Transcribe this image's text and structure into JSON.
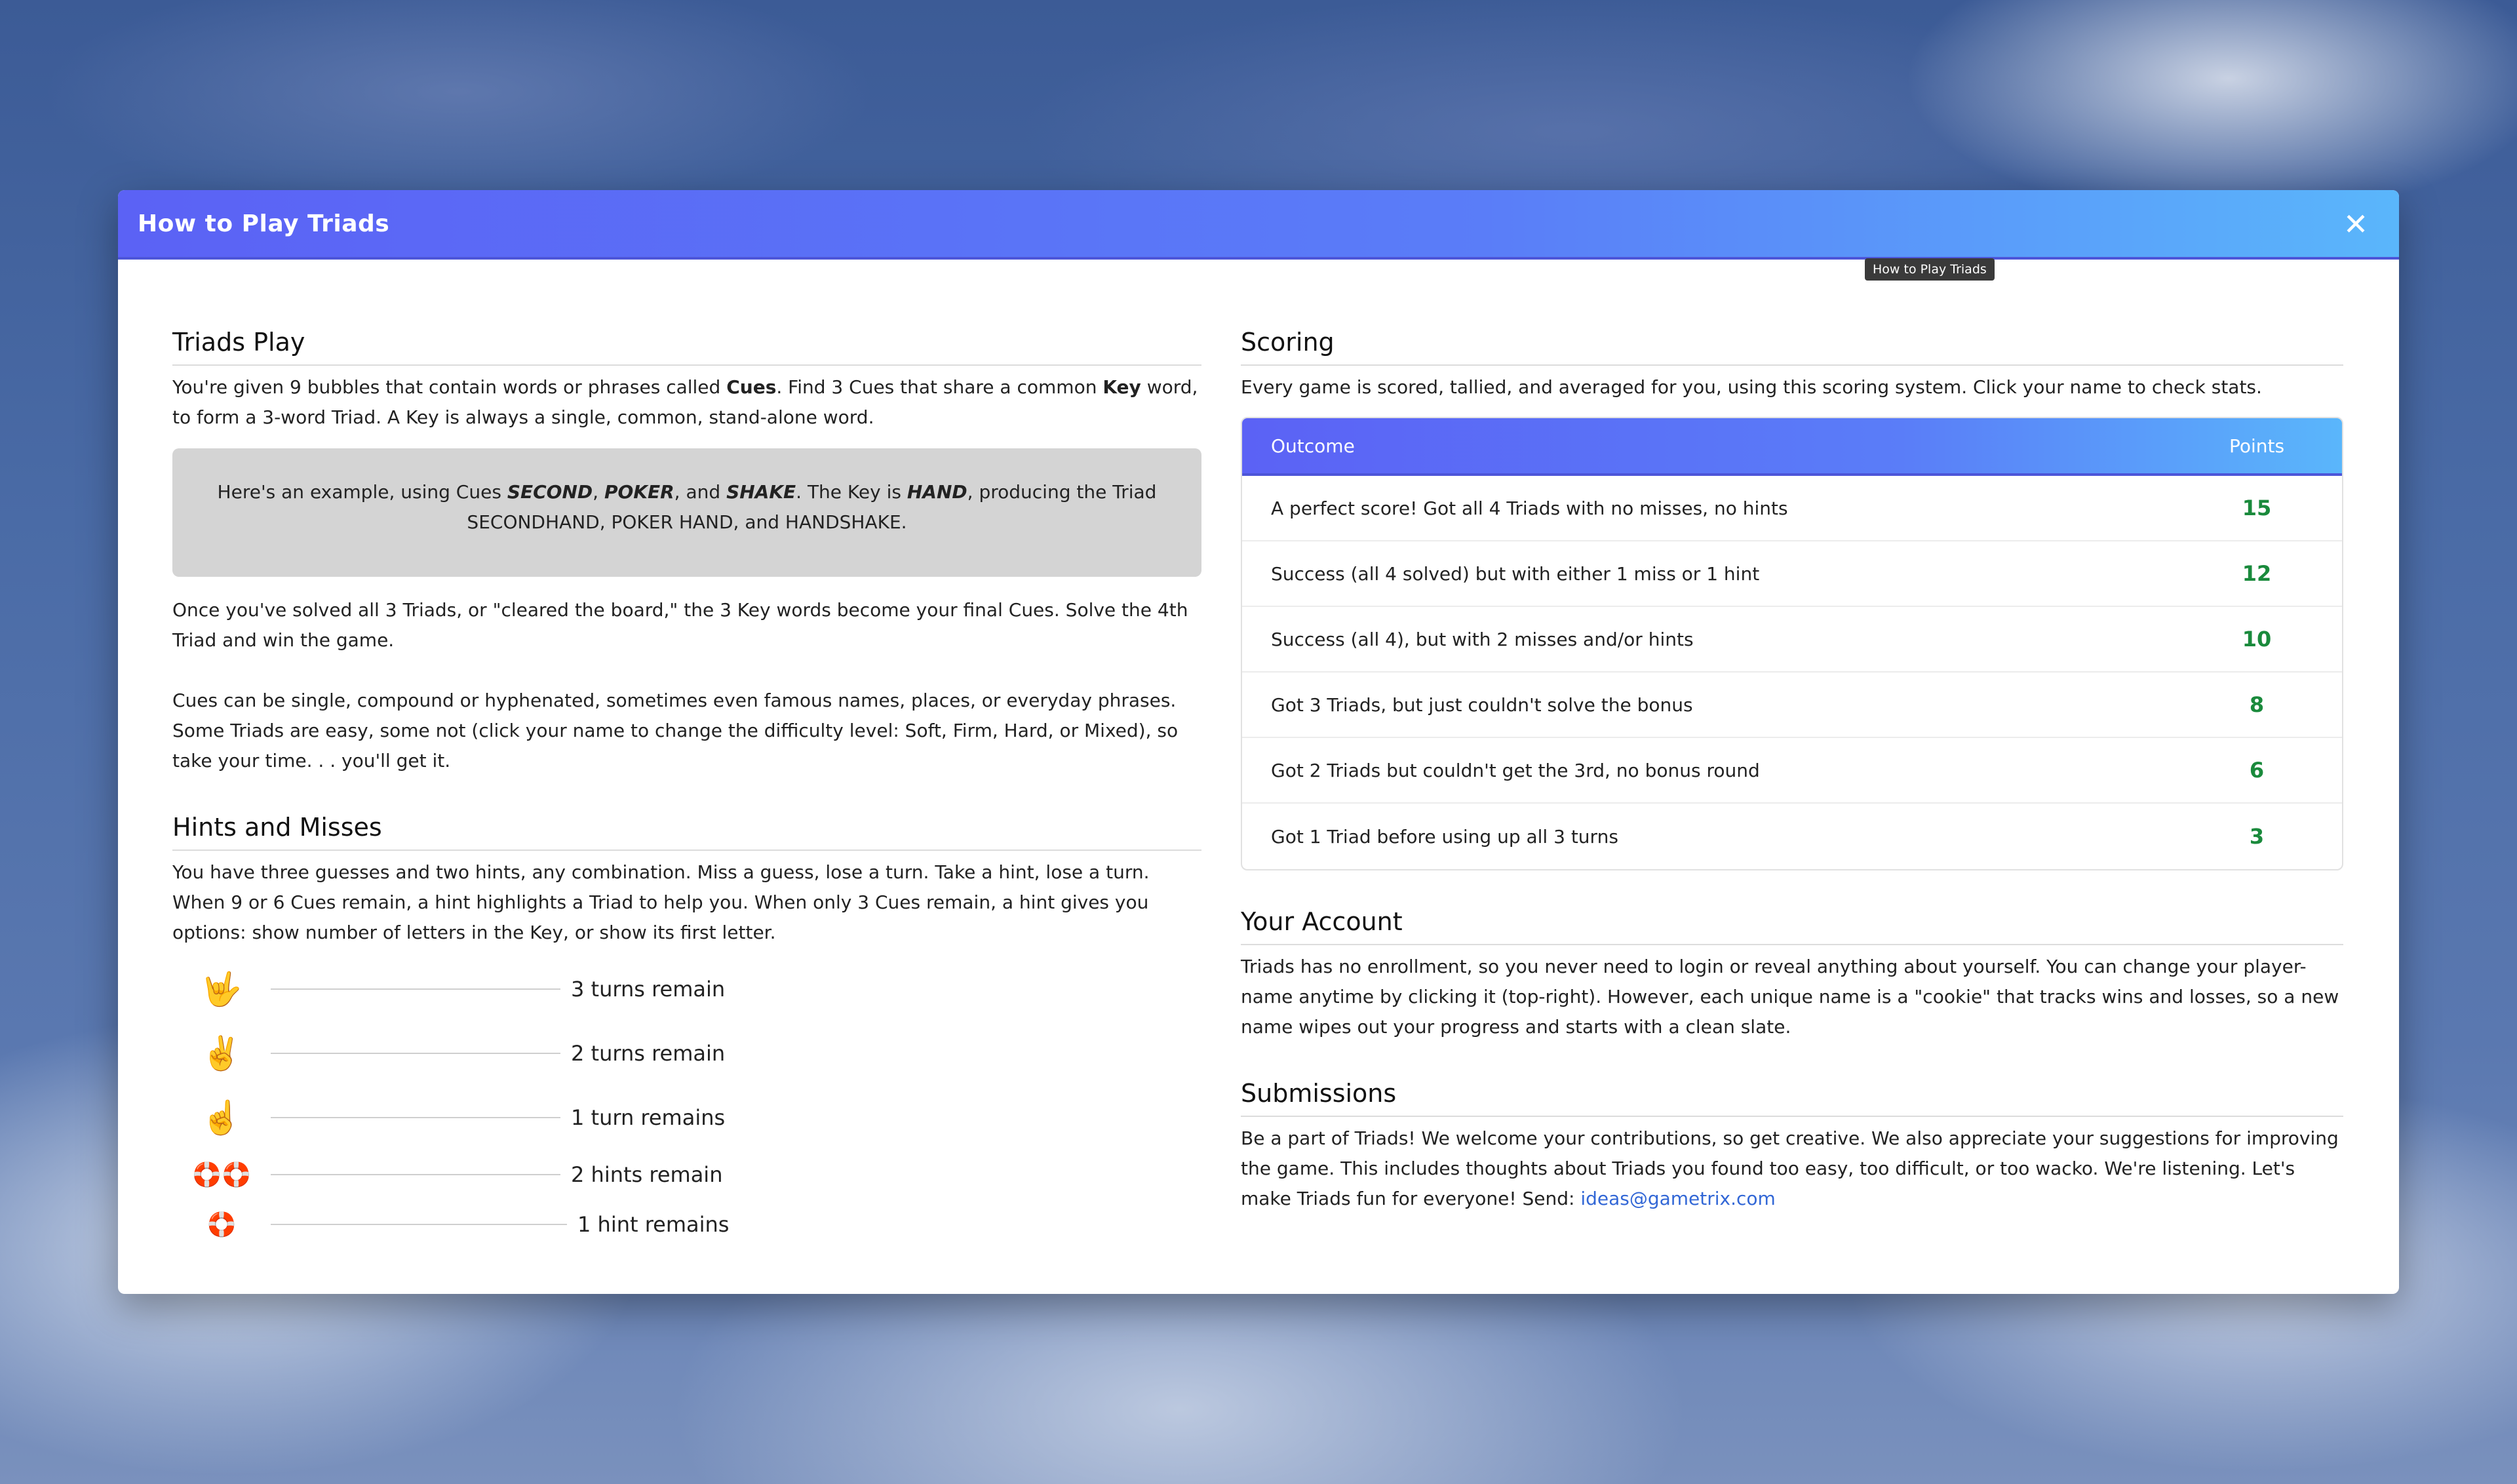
{
  "modal": {
    "title": "How to Play Triads",
    "close_icon": "close-icon",
    "tooltip": "How to Play Triads"
  },
  "triads_play": {
    "heading": "Triads Play",
    "intro_part1": "You're given 9 bubbles that contain words or phrases called ",
    "intro_bold1": "Cues",
    "intro_part2": ". Find 3 Cues that share a common ",
    "intro_bold2": "Key",
    "intro_part3": " word, to form a 3-word Triad. A Key is always a single, common, stand-alone word.",
    "example_part1": "Here's an example, using Cues ",
    "example_cue1": "SECOND",
    "example_sep1": ", ",
    "example_cue2": "POKER",
    "example_sep2": ", and ",
    "example_cue3": "SHAKE",
    "example_part2": ". The Key is ",
    "example_key": "HAND",
    "example_part3": ", producing the Triad SECONDHAND, POKER HAND, and HANDSHAKE.",
    "para2": "Once you've solved all 3 Triads, or \"cleared the board,\" the 3 Key words become your final Cues. Solve the 4th Triad and win the game.",
    "para3": "Cues can be single, compound or hyphenated, sometimes even famous names, places, or everyday phrases. Some Triads are easy, some not (click your name to change the difficulty level: Soft, Firm, Hard, or Mixed), so take your time. . . you'll get it."
  },
  "hints": {
    "heading": "Hints and Misses",
    "text": "You have three guesses and two hints, any combination. Miss a guess, lose a turn. Take a hint, lose a turn. When 9 or 6 Cues remain, a hint highlights a Triad to help you. When only 3 Cues remain, a hint gives you options: show number of letters in the Key, or show its first letter.",
    "items": [
      {
        "icon": "three-fingers-icon",
        "glyph": "🤟",
        "label": "3 turns remain"
      },
      {
        "icon": "two-fingers-icon",
        "glyph": "✌️",
        "label": "2 turns remain"
      },
      {
        "icon": "one-finger-icon",
        "glyph": "☝️",
        "label": "1 turn remains"
      },
      {
        "icon": "lifebuoy-pair-icon",
        "glyph": "🛟🛟",
        "label": "2 hints remain"
      },
      {
        "icon": "lifebuoy-icon",
        "glyph": "🛟",
        "label": "1 hint remains"
      }
    ]
  },
  "scoring": {
    "heading": "Scoring",
    "intro": "Every game is scored, tallied, and averaged for you, using this scoring system. Click your name to check stats.",
    "col_outcome": "Outcome",
    "col_points": "Points",
    "rows": [
      {
        "outcome": "A perfect score! Got all 4 Triads with no misses, no hints",
        "points": "15"
      },
      {
        "outcome": "Success (all 4 solved) but with either 1 miss or 1 hint",
        "points": "12"
      },
      {
        "outcome": "Success (all 4), but with 2 misses and/or hints",
        "points": "10"
      },
      {
        "outcome": "Got 3 Triads, but just couldn't solve the bonus",
        "points": "8"
      },
      {
        "outcome": "Got 2 Triads but couldn't get the 3rd, no bonus round",
        "points": "6"
      },
      {
        "outcome": "Got 1 Triad before using up all 3 turns",
        "points": "3"
      }
    ],
    "points_color": "#1a8a3c"
  },
  "account": {
    "heading": "Your Account",
    "text": "Triads has no enrollment, so you never need to login or reveal anything about yourself. You can change your player-name anytime by clicking it (top-right). However, each unique name is a \"cookie\" that tracks wins and losses, so a new name wipes out your progress and starts with a clean slate."
  },
  "submissions": {
    "heading": "Submissions",
    "text": "Be a part of Triads! We welcome your contributions, so get creative. We also appreciate your suggestions for improving the game. This includes thoughts about Triads you found too easy, too difficult, or too wacko. We're listening. Let's make Triads fun for everyone! Send: ",
    "email": "ideas@gametrix.com"
  },
  "colors": {
    "header_gradient_start": "#5b62f5",
    "header_gradient_end": "#5ab6fb",
    "link": "#3267d6"
  }
}
